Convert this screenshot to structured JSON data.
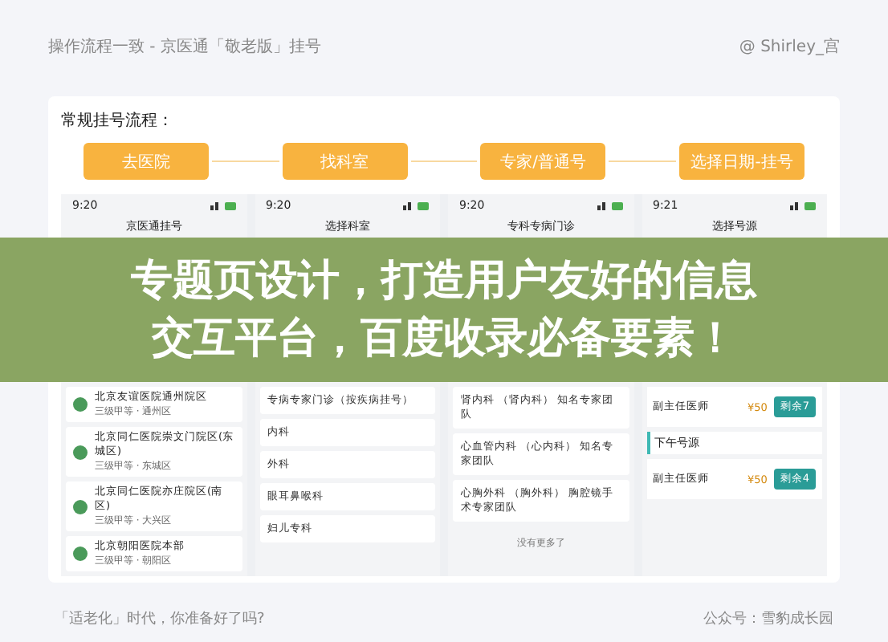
{
  "header": {
    "title": "操作流程一致 - 京医通「敬老版」挂号",
    "author": "@ Shirley_宫"
  },
  "flow": {
    "title": "常规挂号流程：",
    "steps": [
      "去医院",
      "找科室",
      "专家/普通号",
      "选择日期-挂号"
    ]
  },
  "phones": [
    {
      "kind": "hospitals",
      "time": "9:20",
      "title": "京医通挂号",
      "items": [
        {
          "name": "北京友谊医院通州院区",
          "sub": "三级甲等 · 通州区"
        },
        {
          "name": "北京同仁医院崇文门院区(东城区)",
          "sub": "三级甲等 · 东城区"
        },
        {
          "name": "北京同仁医院亦庄院区(南区)",
          "sub": "三级甲等 · 大兴区"
        },
        {
          "name": "北京朝阳医院本部",
          "sub": "三级甲等 · 朝阳区"
        }
      ]
    },
    {
      "kind": "departments",
      "time": "9:20",
      "title": "选择科室",
      "items": [
        "专病专家门诊（按疾病挂号）",
        "内科",
        "外科",
        "眼耳鼻喉科",
        "妇儿专科"
      ]
    },
    {
      "kind": "departments",
      "time": "9:20",
      "title": "专科专病门诊",
      "items": [
        "肾内科 （肾内科）  知名专家团队",
        "心血管内科 （心内科） 知名专家团队",
        "心胸外科 （胸外科） 胸腔镜手术专家团队"
      ],
      "footer": "没有更多了"
    },
    {
      "kind": "doctors",
      "time": "9:21",
      "title": "选择号源",
      "items": [
        {
          "kind": "doctor",
          "title": "副主任医师",
          "price": "¥50",
          "action": "剩余7"
        },
        {
          "kind": "section",
          "title": "下午号源"
        },
        {
          "kind": "doctor",
          "title": "副主任医师",
          "price": "¥50",
          "action": "剩余4"
        }
      ]
    }
  ],
  "overlay_banner": [
    "专题页设计，打造用户友好的信息",
    "交互平台，百度收录必备要素！"
  ],
  "footer": {
    "left": "「适老化」时代，你准备好了吗?",
    "right": "公众号：雪豹成长园"
  }
}
